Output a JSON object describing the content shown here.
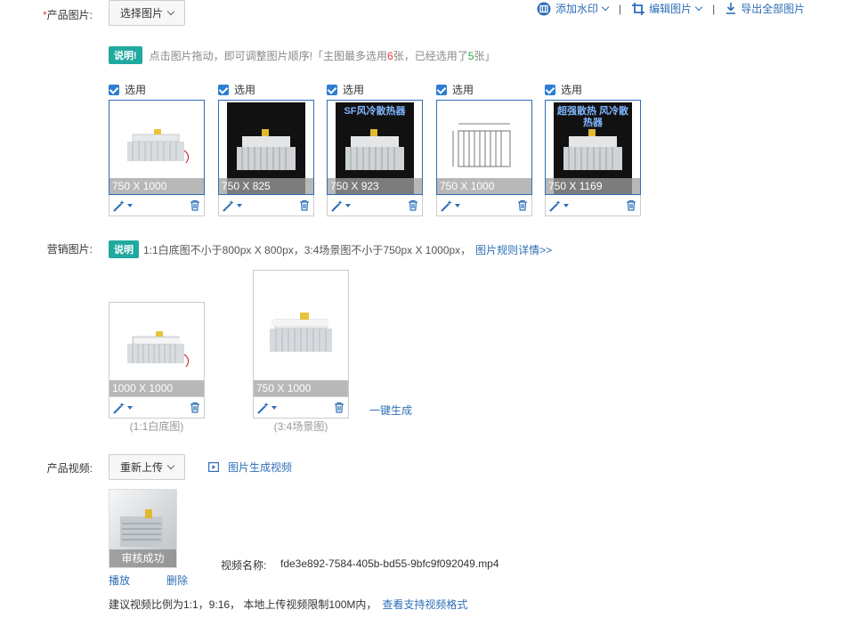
{
  "product_images": {
    "label_required": "*",
    "label": "产品图片:",
    "select_button": "选择图片",
    "toolbar": {
      "watermark": "添加水印",
      "edit": "编辑图片",
      "export": "导出全部图片",
      "separator": "|"
    },
    "notice_badge": "说明!",
    "notice_text_1": "点击图片拖动，即可调整图片顺序!「主图最多选用",
    "notice_max": "6",
    "notice_text_2": "张，已经选用了",
    "notice_used": "5",
    "notice_text_3": "张」",
    "items": [
      {
        "check_label": "选用",
        "dims": "750 X 1000",
        "theme": "light"
      },
      {
        "check_label": "选用",
        "dims": "750 X 825",
        "theme": "dark"
      },
      {
        "check_label": "选用",
        "dims": "750 X 923",
        "theme": "dark",
        "overlay_text": "SF风冷散热器"
      },
      {
        "check_label": "选用",
        "dims": "750 X 1000",
        "theme": "drawing"
      },
      {
        "check_label": "选用",
        "dims": "750 X 1169",
        "theme": "dark",
        "overlay_text": "超强散热 风冷散热器"
      }
    ]
  },
  "marketing_images": {
    "label": "营销图片:",
    "badge": "说明",
    "text": "1:1白底图不小于800px X 800px，3:4场景图不小于750px X 1000px，",
    "rules_link": "图片规则详情>>",
    "items": [
      {
        "dims": "1000 X 1000",
        "caption": "(1:1白底图)"
      },
      {
        "dims": "750 X 1000",
        "caption": "(3:4场景图)"
      }
    ],
    "generate_link": "一键生成"
  },
  "product_video": {
    "label": "产品视频:",
    "reupload_button": "重新上传",
    "generate_video_link": "图片生成视频",
    "status": "审核成功",
    "play_link": "播放",
    "delete_link": "删除",
    "filename_label": "视频名称:",
    "filename": "fde3e892-7584-405b-bd55-9bfc9f092049.mp4",
    "hint": "建议视频比例为1:1，9:16， 本地上传视频限制100M内，",
    "formats_link": "查看支持视频格式"
  },
  "colors": {
    "accent": "#2d6fb7",
    "badge": "#1fa9a0",
    "checkbox": "#2d7dd2",
    "red": "#e4393c",
    "green": "#2aa54a"
  }
}
